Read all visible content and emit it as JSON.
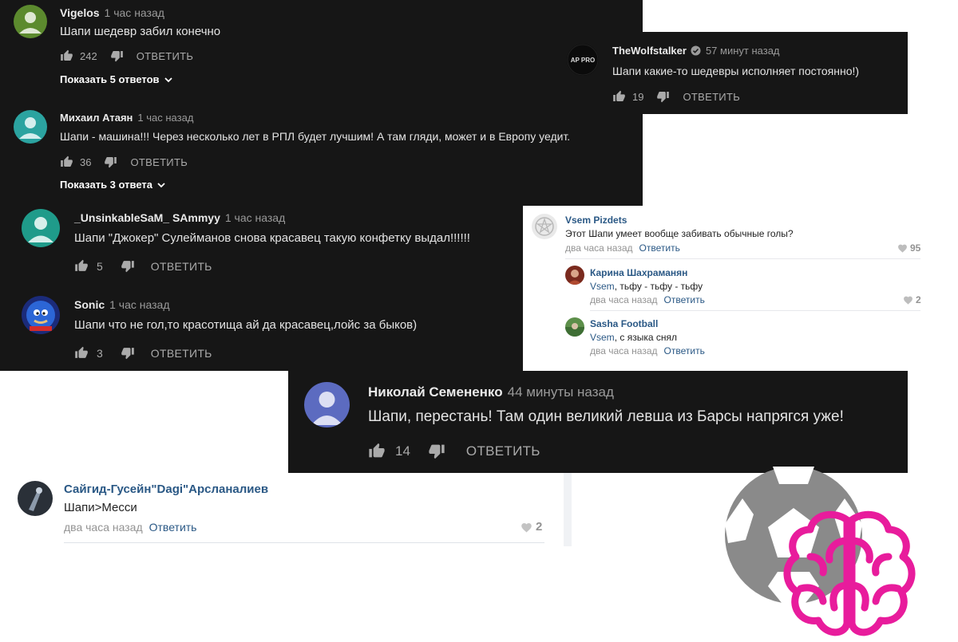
{
  "panel_main": {
    "comments": [
      {
        "author": "Vigelos",
        "time": "1 час назад",
        "text": "Шапи шедевр забил конечно",
        "likes": "242",
        "reply": "ОТВЕТИТЬ",
        "show_replies": "Показать 5 ответов"
      },
      {
        "author": "Михаил Атаян",
        "time": "1 час назад",
        "text": "Шапи - машина!!! Через несколько лет в РПЛ будет лучшим! А там  гляди, может и в Европу  уедит.",
        "likes": "36",
        "reply": "ОТВЕТИТЬ",
        "show_replies": "Показать 3 ответа"
      }
    ]
  },
  "panel_wolf": {
    "author": "TheWolfstalker",
    "time": "57 минут назад",
    "text": "Шапи какие-то шедевры исполняет постоянно!)",
    "likes": "19",
    "reply": "ОТВЕТИТЬ",
    "avatar_text": "AP PRO"
  },
  "panel_second": {
    "comments": [
      {
        "author": "_UnsinkableSaM_ SAmmyy",
        "time": "1 час назад",
        "text": "Шапи \"Джокер\" Сулейманов снова красавец такую конфетку выдал!!!!!!",
        "likes": "5",
        "reply": "ОТВЕТИТЬ"
      },
      {
        "author": "Sonic",
        "time": "1 час назад",
        "text": "Шапи что не гол,то красотища ай да красавец,лойс за быков)",
        "likes": "3",
        "reply": "ОТВЕТИТЬ"
      }
    ]
  },
  "vk_thread": {
    "main": {
      "name": "Vsem Pizdets",
      "text": "Этот Шапи умеет вообще забивать обычные голы?",
      "time": "два часа назад",
      "reply": "Ответить",
      "likes": "95"
    },
    "replies": [
      {
        "name": "Карина Шахраманян",
        "mention": "Vsem",
        "text": ", тьфу - тьфу - тьфу",
        "time": "два часа назад",
        "reply": "Ответить",
        "likes": "2"
      },
      {
        "name": "Sasha Football",
        "mention": "Vsem",
        "text": ", с языка снял",
        "time": "два часа назад",
        "reply": "Ответить"
      }
    ]
  },
  "panel_nikolai": {
    "author": "Николай Семененко",
    "time": "44 минуты назад",
    "text": "Шапи, перестань! Там один великий левша из Барсы напрягся уже!",
    "likes": "14",
    "reply": "ОТВЕТИТЬ"
  },
  "vk_bottom": {
    "name": "Сайгид-Гусейн\"Dagi\"Арсланалиев",
    "text": "Шапи>Месси",
    "time": "два часа назад",
    "reply": "Ответить",
    "likes": "2"
  },
  "colors": {
    "dark_bg": "#161616",
    "vk_link": "#2a5885",
    "brain": "#e81c9c",
    "ball": "#8a8a8a"
  },
  "icons": [
    "thumb-up-icon",
    "thumb-down-icon",
    "chevron-down-icon",
    "heart-icon",
    "soccer-ball-icon",
    "brain-icon",
    "verified-check-icon"
  ]
}
